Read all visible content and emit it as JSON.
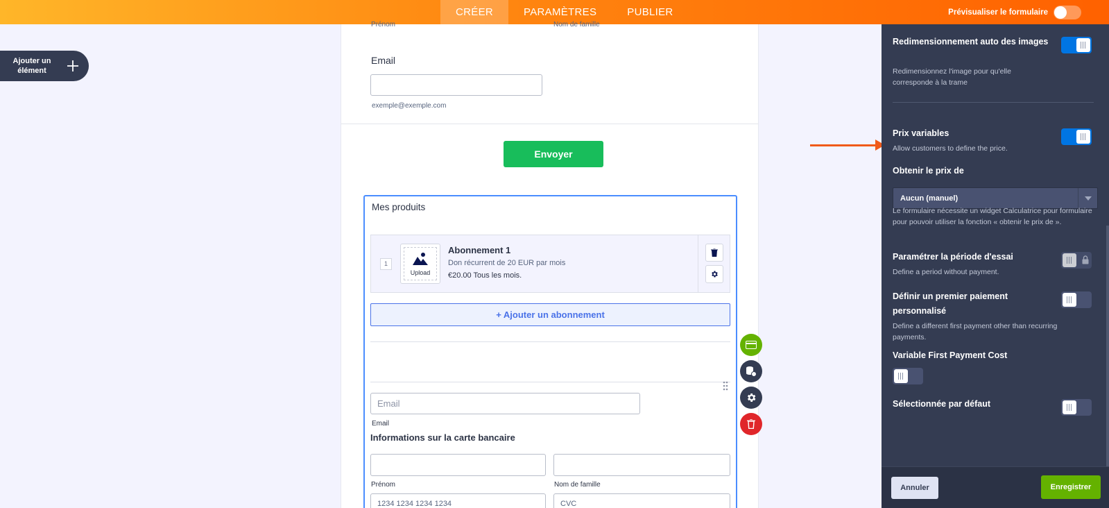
{
  "topbar": {
    "tabs": [
      {
        "label": "CRÉER",
        "active": true
      },
      {
        "label": "PARAMÈTRES",
        "active": false
      },
      {
        "label": "PUBLIER",
        "active": false
      }
    ],
    "preview_label": "Prévisualiser le formulaire",
    "preview_on": false,
    "gradient": [
      "#ffb629",
      "#ff6100"
    ]
  },
  "add_element": {
    "label": "Ajouter un élément",
    "icon": "plus-icon"
  },
  "form": {
    "prev_labels": {
      "first": "Prénom",
      "last": "Nom de famille"
    },
    "email_label": "Email",
    "email_hint": "exemple@exemple.com",
    "submit_label": "Envoyer",
    "products": {
      "title": "Mes produits",
      "item": {
        "qty": "1",
        "upload_label": "Upload",
        "name": "Abonnement 1",
        "description": "Don récurrent de 20 EUR par mois",
        "price": "€20.00",
        "period": "Tous les mois."
      },
      "add_subscription_label": "+ Ajouter un abonnement",
      "email_placeholder": "Email",
      "email_sublabel": "Email",
      "card_title": "Informations sur la carte bancaire",
      "first_name_label": "Prénom",
      "last_name_label": "Nom de famille",
      "card_number_text": "1234 1234 1234 1234",
      "cvc_text": "CVC"
    }
  },
  "panel": {
    "sections": [
      {
        "title": "Redimensionnement auto des images",
        "desc": "Redimensionnez l'image pour qu'elle corresponde à la trame",
        "on": true
      },
      {
        "title": "Prix variables",
        "desc": "Allow customers to define the price.",
        "on": true
      },
      {
        "title": "Obtenir le prix de",
        "select_value": "Aucun (manuel)",
        "desc": "Le formulaire nécessite un widget Calculatrice pour formulaire pour pouvoir utiliser la fonction « obtenir le prix de »."
      },
      {
        "title": "Paramétrer la période d'essai",
        "desc": "Define a period without payment.",
        "on": false,
        "locked": true
      },
      {
        "title": "Définir un premier paiement personnalisé",
        "desc": "Define a different first payment other than recurring payments.",
        "on": false
      },
      {
        "title": "Variable First Payment Cost",
        "on": false
      },
      {
        "title": "Sélectionnée par défaut",
        "on": false
      }
    ],
    "cancel_label": "Annuler",
    "save_label": "Enregistrer"
  },
  "colors": {
    "accent_orange": "#f05a19",
    "toggle_on": "#0075e3",
    "save_green": "#64b200",
    "submit_green": "#18bd5b",
    "panel_bg": "#343c52"
  }
}
